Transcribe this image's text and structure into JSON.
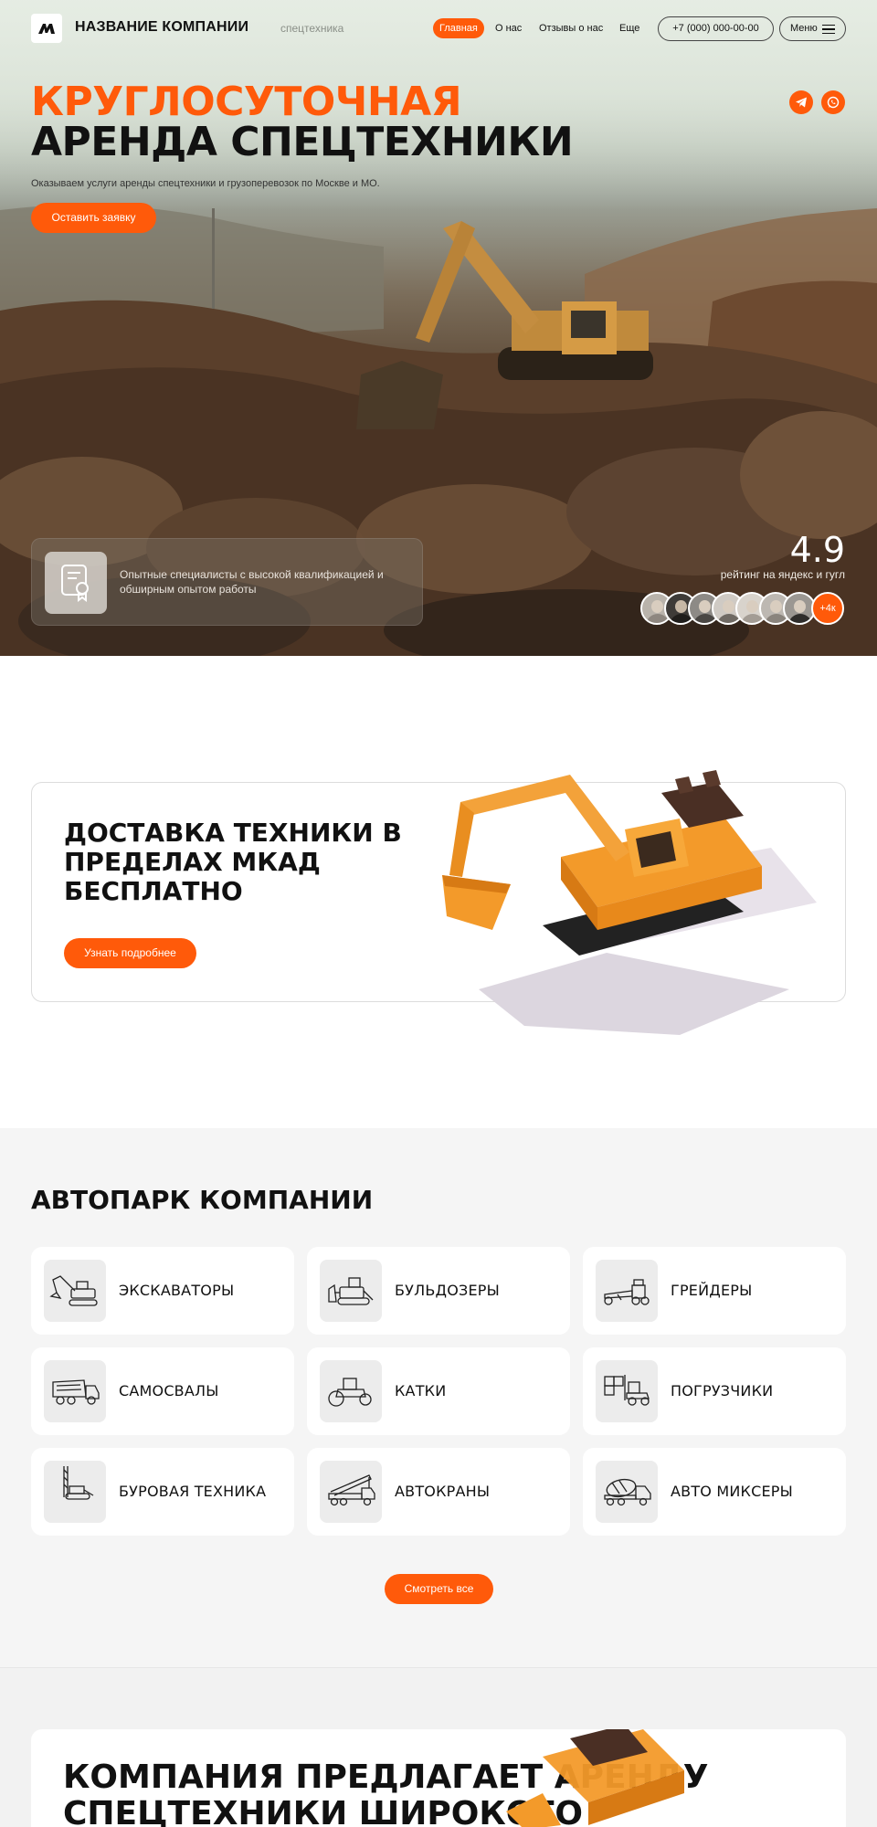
{
  "header": {
    "brand": "НАЗВАНИЕ КОМПАНИИ",
    "brand_sub": "спецтехника",
    "nav": [
      {
        "label": "Главная",
        "active": true
      },
      {
        "label": "О нас",
        "active": false
      },
      {
        "label": "Отзывы о нас",
        "active": false
      },
      {
        "label": "Еще",
        "active": false
      }
    ],
    "phone": "+7 (000) 000-00-00",
    "menu_label": "Меню"
  },
  "hero": {
    "title_line1": "КРУГЛОСУТОЧНАЯ",
    "title_line2": "АРЕНДА СПЕЦТЕХНИКИ",
    "subtitle": "Оказываем услуги аренды спецтехники и грузоперевозок по Москве и МО.",
    "cta_label": "Оставить заявку",
    "socials": [
      "telegram-icon",
      "whatsapp-icon"
    ],
    "feature_text": "Опытные специалисты с высокой квалификацией и обширным опытом работы",
    "rating_value": "4.9",
    "rating_label": "рейтинг на яндекс и гугл",
    "reviewers_more": "+4к"
  },
  "delivery": {
    "title": "ДОСТАВКА ТЕХНИКИ В ПРЕДЕЛАХ МКАД БЕСПЛАТНО",
    "cta_label": "Узнать подробнее"
  },
  "fleet": {
    "title": "АВТОПАРК КОМПАНИИ",
    "items": [
      {
        "label": "ЭКСКАВАТОРЫ",
        "icon": "excavator-icon"
      },
      {
        "label": "БУЛЬДОЗЕРЫ",
        "icon": "bulldozer-icon"
      },
      {
        "label": "ГРЕЙДЕРЫ",
        "icon": "grader-icon"
      },
      {
        "label": "САМОСВАЛЫ",
        "icon": "dump-truck-icon"
      },
      {
        "label": "КАТКИ",
        "icon": "road-roller-icon"
      },
      {
        "label": "ПОГРУЗЧИКИ",
        "icon": "loader-icon"
      },
      {
        "label": "БУРОВАЯ ТЕХНИКА",
        "icon": "drilling-rig-icon"
      },
      {
        "label": "АВТОКРАНЫ",
        "icon": "truck-crane-icon"
      },
      {
        "label": "АВТО МИКСЕРЫ",
        "icon": "concrete-mixer-icon"
      }
    ],
    "cta_label": "Смотреть все"
  },
  "offer": {
    "title": "КОМПАНИЯ ПРЕДЛАГАЕТ АРЕНДУ СПЕЦТЕХНИКИ ШИРОКОГО"
  },
  "colors": {
    "accent": "#ff5a0a",
    "text": "#111111",
    "section_bg": "#f5f5f5"
  }
}
